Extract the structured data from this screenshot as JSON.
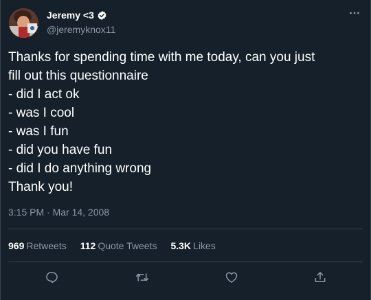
{
  "user": {
    "display_name": "Jeremy <3",
    "handle": "@jeremyknox11"
  },
  "tweet": {
    "lines": [
      "Thanks for spending time with me today, can you just",
      "fill out this questionnaire",
      "- did I act ok",
      "- was I cool",
      "- was I fun",
      "- did you have fun",
      "- did I do anything wrong",
      "Thank you!"
    ],
    "timestamp": "3:15 PM · Mar 14, 2008"
  },
  "stats": {
    "retweets_count": "969",
    "retweets_label": "Retweets",
    "quotes_count": "112",
    "quotes_label": "Quote Tweets",
    "likes_count": "5.3K",
    "likes_label": "Likes"
  },
  "colors": {
    "background": "#15202b",
    "secondary_text": "#8b98a5",
    "divider": "#38444d",
    "verified_badge": "#ffffff"
  },
  "icons": {
    "more": "more-dots-icon",
    "verified": "verified-badge-icon",
    "reply": "reply-icon",
    "retweet": "retweet-icon",
    "like": "like-icon",
    "share": "share-icon"
  }
}
